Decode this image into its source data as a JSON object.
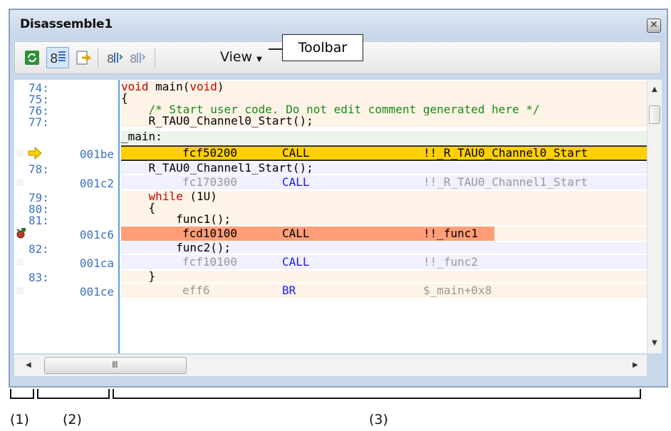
{
  "window": {
    "title": "Disassemble1"
  },
  "toolbar": {
    "view_label": "View",
    "callout": "Toolbar",
    "buttons": [
      "refresh-icon",
      "mixed-display-icon",
      "goto-icon",
      "step-in-icon",
      "step-over-icon"
    ]
  },
  "rows": [
    {
      "type": "src",
      "addr": "74:",
      "code": "void main(void)"
    },
    {
      "type": "src",
      "addr": "75:",
      "code": "{"
    },
    {
      "type": "src",
      "addr": "76:",
      "code": "    /* Start user code. Do not edit comment generated here */"
    },
    {
      "type": "src",
      "addr": "77:",
      "code": "    R_TAU0_Channel0_Start();"
    },
    {
      "type": "lbl",
      "addr": "",
      "code": "_main:"
    },
    {
      "type": "cur",
      "addr": "001be",
      "code": "fcf50200",
      "mnem": "CALL",
      "oper": "!!_R_TAU0_Channel0_Start"
    },
    {
      "type": "src",
      "addr": "78:",
      "code": "    R_TAU0_Channel1_Start();"
    },
    {
      "type": "dis",
      "addr": "001c2",
      "code": "fc170300",
      "mnem": "CALL",
      "oper": "!!_R_TAU0_Channel1_Start"
    },
    {
      "type": "src",
      "addr": "79:",
      "code": "    while (1U)"
    },
    {
      "type": "src",
      "addr": "80:",
      "code": "    {"
    },
    {
      "type": "src",
      "addr": "81:",
      "code": "        func1();"
    },
    {
      "type": "brk",
      "addr": "001c6",
      "code": "fcd10100",
      "mnem": "CALL",
      "oper": "!!_func1"
    },
    {
      "type": "src",
      "addr": "82:",
      "code": "        func2();"
    },
    {
      "type": "dis",
      "addr": "001ca",
      "code": "fcf10100",
      "mnem": "CALL",
      "oper": "!!_func2"
    },
    {
      "type": "src",
      "addr": "83:",
      "code": "    }"
    },
    {
      "type": "dis",
      "addr": "001ce",
      "code": "eff6",
      "mnem": "BR",
      "oper": "$_main+0x8"
    }
  ],
  "scrollbar": {
    "h_grip": "III"
  },
  "labels": [
    "(1)",
    "(2)",
    "(3)"
  ],
  "colors": {
    "current_pc": "#ffd000",
    "breakpoint": "#ff9e78",
    "source_bg": "#fdf3e6",
    "disasm_bg": "#f0f0ff",
    "address": "#3c72c2",
    "mnemonic": "#1a1aff"
  }
}
